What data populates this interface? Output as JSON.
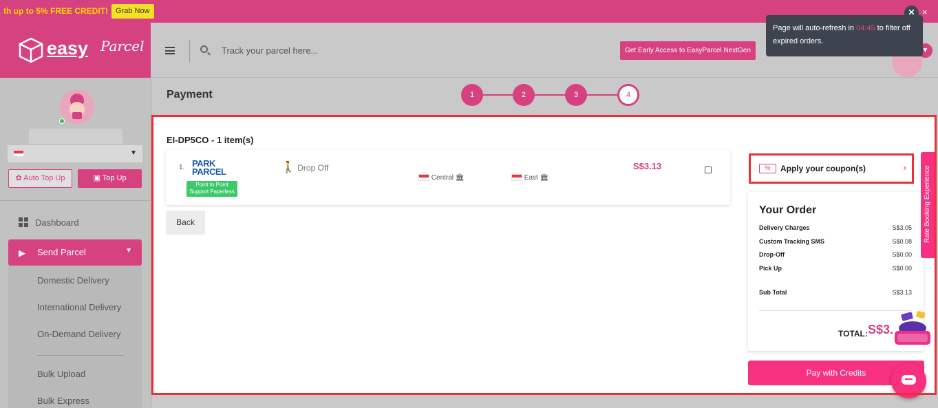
{
  "promo": {
    "text": "th up to 5% FREE CREDIT!",
    "cta": "Grab Now",
    "close": "×"
  },
  "brand": {
    "name": "easy",
    "script": "Parcel"
  },
  "tooltip": {
    "prefix": "Page will auto-refresh in ",
    "time": "04:45",
    "suffix": " to filter off expired orders.",
    "close": "✕"
  },
  "header": {
    "search_placeholder": "Track your parcel here...",
    "nextgen": "Get Early Access to EasyParcel NextGen"
  },
  "sidebar": {
    "auto_top_up": "Auto Top Up",
    "top_up": "Top Up",
    "dashboard": "Dashboard",
    "send_parcel": "Send Parcel",
    "sub_items": [
      "Domestic Delivery",
      "International Delivery",
      "On-Demand Delivery",
      "Bulk Upload",
      "Bulk Express"
    ]
  },
  "page": {
    "title": "Payment",
    "steps": [
      "1",
      "2",
      "3",
      "4"
    ],
    "current_step": 4
  },
  "order": {
    "id_line": "EI-DP5CO - 1 item(s)",
    "row": {
      "num": "1.",
      "courier_top": "PARK\nPARCEL",
      "courier_badge": "Point to Point\nSupport Paperless",
      "service": "Drop Off",
      "from": "Central",
      "to": "East",
      "price": "S$3.13"
    },
    "back": "Back"
  },
  "coupon": {
    "label": "Apply your coupon(s)",
    "icon": "%"
  },
  "summary": {
    "title": "Your Order",
    "lines": [
      {
        "label": "Delivery Charges",
        "value": "S$3.05"
      },
      {
        "label": "Custom Tracking SMS",
        "value": "S$0.08"
      },
      {
        "label": "Drop-Off",
        "value": "S$0.00"
      },
      {
        "label": "Pick Up",
        "value": "S$0.00"
      }
    ],
    "subtotal_label": "Sub Total",
    "subtotal_value": "S$3.13",
    "total_label": "TOTAL:",
    "total_value": "S$3."
  },
  "pay_button": "Pay with Credits",
  "rate_tab": "Rate Booking Experience",
  "colors": {
    "brand": "#d6417f",
    "accent": "#f7307f",
    "highlight": "#ee2f35"
  }
}
